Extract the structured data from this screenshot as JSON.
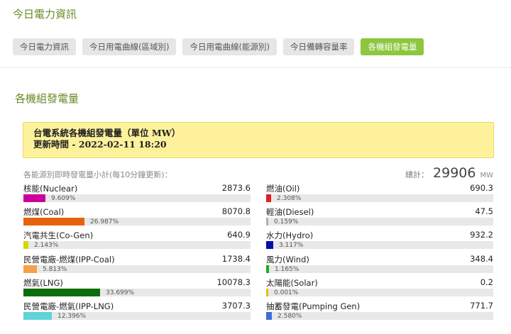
{
  "header": {
    "title": "今日電力資訊",
    "tabs": [
      {
        "label": "今日電力資訊",
        "active": false
      },
      {
        "label": "今日用電曲線(區域別)",
        "active": false
      },
      {
        "label": "今日用電曲線(能源別)",
        "active": false
      },
      {
        "label": "今日備轉容量率",
        "active": false
      },
      {
        "label": "各機組發電量",
        "active": true
      }
    ]
  },
  "section_title": "各機組發電量",
  "notice": {
    "line1": "台電系統各機組發電量（單位 MW）",
    "line2": "更新時間 - 2022-02-11 18:20"
  },
  "subtitle": "各能源別即時發電量小計(每10分鐘更新)：",
  "total": {
    "label": "總計：",
    "value": "29906",
    "unit": "MW"
  },
  "colors": {
    "accent": "#8dc63f",
    "header_text": "#6a8a25",
    "notice_bg": "#fdf29b"
  },
  "sources_left": [
    {
      "name": "核能(Nuclear)",
      "value": "2873.6",
      "percent": "9.609%",
      "fraction": 0.09609,
      "color": "#cc0099"
    },
    {
      "name": "燃煤(Coal)",
      "value": "8070.8",
      "percent": "26.987%",
      "fraction": 0.26987,
      "color": "#e8620e"
    },
    {
      "name": "汽電共生(Co-Gen)",
      "value": "640.9",
      "percent": "2.143%",
      "fraction": 0.02143,
      "color": "#d6d600"
    },
    {
      "name": "民營電廠-燃煤(IPP-Coal)",
      "value": "1738.4",
      "percent": "5.813%",
      "fraction": 0.05813,
      "color": "#f5a04a"
    },
    {
      "name": "燃氣(LNG)",
      "value": "10078.3",
      "percent": "33.699%",
      "fraction": 0.33699,
      "color": "#0b6e0b"
    },
    {
      "name": "民營電廠-燃氣(IPP-LNG)",
      "value": "3707.3",
      "percent": "12.396%",
      "fraction": 0.12396,
      "color": "#5fd3d6"
    }
  ],
  "sources_right": [
    {
      "name": "燃油(Oil)",
      "value": "690.3",
      "percent": "2.308%",
      "fraction": 0.02308,
      "color": "#e61e1e"
    },
    {
      "name": "輕油(Diesel)",
      "value": "47.5",
      "percent": "0.159%",
      "fraction": 0.00159,
      "color": "#b0b0b0"
    },
    {
      "name": "水力(Hydro)",
      "value": "932.2",
      "percent": "3.117%",
      "fraction": 0.03117,
      "color": "#0010a8"
    },
    {
      "name": "風力(Wind)",
      "value": "348.4",
      "percent": "1.165%",
      "fraction": 0.01165,
      "color": "#18b018"
    },
    {
      "name": "太陽能(Solar)",
      "value": "0.2",
      "percent": "0.001%",
      "fraction": 1e-05,
      "color": "#e0c000"
    },
    {
      "name": "抽蓄發電(Pumping Gen)",
      "value": "771.7",
      "percent": "2.580%",
      "fraction": 0.0258,
      "color": "#3a6fd8"
    }
  ]
}
